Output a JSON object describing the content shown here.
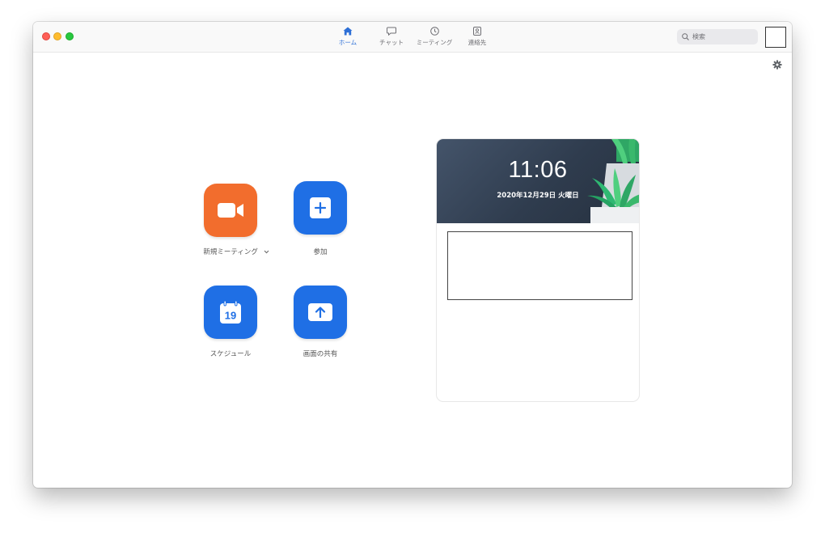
{
  "nav": {
    "tabs": [
      {
        "label": "ホーム",
        "icon": "home-icon",
        "active": true
      },
      {
        "label": "チャット",
        "icon": "chat-bubble-icon",
        "active": false
      },
      {
        "label": "ミーティング",
        "icon": "clock-icon",
        "active": false
      },
      {
        "label": "連絡先",
        "icon": "contact-card-icon",
        "active": false
      }
    ]
  },
  "search": {
    "placeholder": "検索"
  },
  "actions": {
    "new_meeting": {
      "label": "新規ミーティング",
      "icon": "video-camera-icon"
    },
    "join": {
      "label": "参加",
      "icon": "plus-icon"
    },
    "schedule": {
      "label": "スケジュール",
      "icon": "calendar-icon",
      "calendar_day": "19"
    },
    "share_screen": {
      "label": "画面の共有",
      "icon": "upload-arrow-icon"
    }
  },
  "clock_card": {
    "time": "11:06",
    "date": "2020年12月29日 火曜日"
  },
  "colors": {
    "accent_blue": "#1f6fe5",
    "accent_orange": "#f26d2d",
    "active_tab": "#2d6fd6"
  }
}
